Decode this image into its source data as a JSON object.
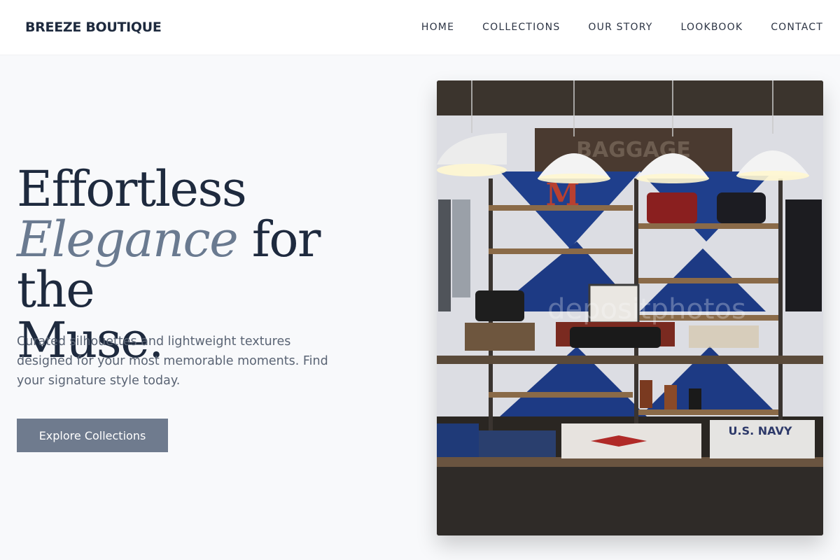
{
  "header": {
    "brand": "BREEZE BOUTIQUE",
    "nav": [
      "HOME",
      "COLLECTIONS",
      "OUR STORY",
      "LOOKBOOK",
      "CONTACT"
    ]
  },
  "hero": {
    "headline_line1": "Effortless",
    "headline_emphasis": "Elegance",
    "headline_line2_rest": " for the",
    "headline_line3": "Muse.",
    "subtext": "Curated silhouettes and lightweight textures designed for your most memorable moments. Find your signature style today.",
    "cta_label": "Explore Collections"
  },
  "image": {
    "sign_text": "BAGGAGE",
    "letter_sign": "M",
    "shirt_text": "U.S. NAVY",
    "watermark": "depositphotos"
  },
  "colors": {
    "accent": "#6f7b8e",
    "heading": "#1e2a3e",
    "emphasis": "#6a7a90",
    "body_text": "#5a6474",
    "background": "#f8f9fb"
  }
}
